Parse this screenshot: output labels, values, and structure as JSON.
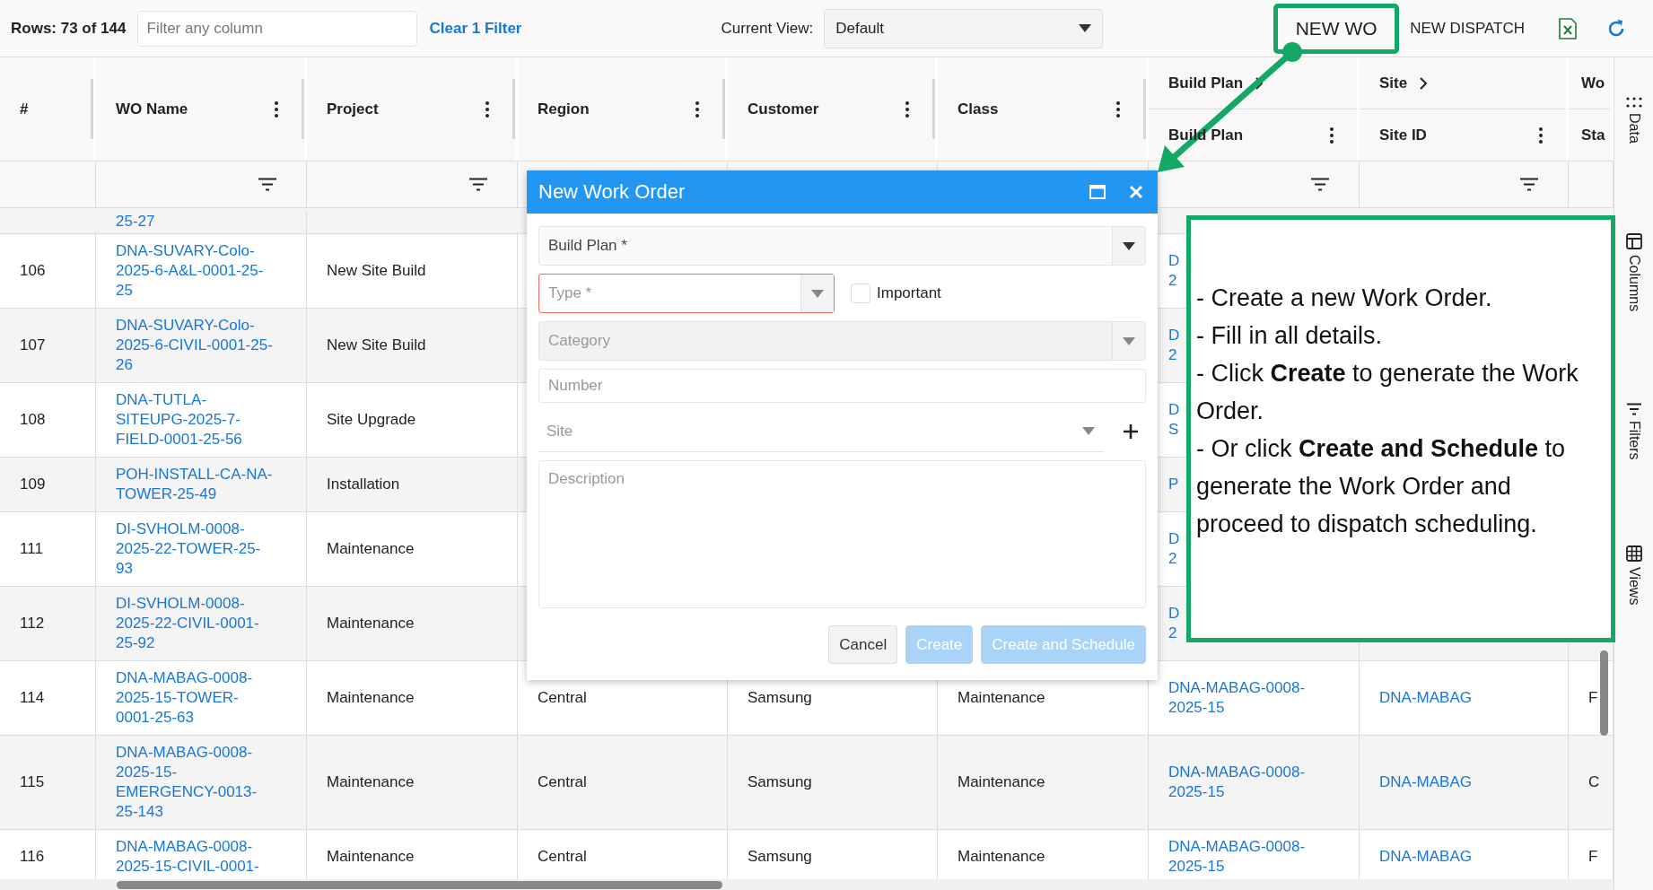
{
  "toolbar": {
    "rows_count": "Rows: 73 of 144",
    "filter": {
      "placeholder": "Filter any column"
    },
    "clear_filter": "Clear 1 Filter",
    "view_label": "Current View:",
    "view_value": "Default",
    "buttons": [
      {
        "label": "NEW WO",
        "highlighted": true
      },
      {
        "label": "NEW DISPATCH",
        "highlighted": false
      }
    ]
  },
  "table": {
    "columns": [
      {
        "label": "#",
        "menu": false,
        "filter": false
      },
      {
        "label": "WO Name",
        "menu": true,
        "filter": true
      },
      {
        "label": "Project",
        "menu": true,
        "filter": true
      },
      {
        "label": "Region",
        "menu": true,
        "filter": false
      },
      {
        "label": "Customer",
        "menu": true,
        "filter": false
      },
      {
        "label": "Class",
        "menu": true,
        "filter": false
      },
      {
        "group": "Build Plan",
        "group_chevron": true,
        "label": "Build Plan",
        "menu": true,
        "filter": true
      },
      {
        "group": "Site",
        "group_chevron": true,
        "label": "Site ID",
        "menu": true,
        "filter": true
      },
      {
        "group": "Wo",
        "group_chevron": false,
        "label": "Sta",
        "menu": false,
        "filter": false
      }
    ],
    "rows": [
      {
        "num": "",
        "wo_name": "25-27"
      },
      {
        "num": "106",
        "wo_name": "DNA-SUVARY-Colo-2025-6-A&L-0001-25-25",
        "project": "New Site Build",
        "build_plan": "D 2",
        "cut": true
      },
      {
        "num": "107",
        "wo_name": "DNA-SUVARY-Colo-2025-6-CIVIL-0001-25-26",
        "project": "New Site Build",
        "build_plan": "D 2",
        "cut": true
      },
      {
        "num": "108",
        "wo_name": "DNA-TUTLA-SITEUPG-2025-7-FIELD-0001-25-56",
        "project": "Site Upgrade",
        "build_plan": "D S",
        "cut": true
      },
      {
        "num": "109",
        "wo_name": "POH-INSTALL-CA-NA-TOWER-25-49",
        "project": "Installation",
        "build_plan": "P",
        "cut": true
      },
      {
        "num": "111",
        "wo_name": "DI-SVHOLM-0008-2025-22-TOWER-25-93",
        "project": "Maintenance",
        "build_plan": "D 2",
        "cut": true
      },
      {
        "num": "112",
        "wo_name": "DI-SVHOLM-0008-2025-22-CIVIL-0001-25-92",
        "project": "Maintenance",
        "build_plan": "D 2",
        "cut": true
      },
      {
        "num": "114",
        "wo_name": "DNA-MABAG-0008-2025-15-TOWER-0001-25-63",
        "project": "Maintenance",
        "region": "Central",
        "customer": "Samsung",
        "class": "Maintenance",
        "build_plan": "DNA-MABAG-0008-2025-15",
        "site_id": "DNA-MABAG",
        "status": "F",
        "cut": false
      },
      {
        "num": "115",
        "wo_name": "DNA-MABAG-0008-2025-15-EMERGENCY-0013-25-143",
        "project": "Maintenance",
        "region": "Central",
        "customer": "Samsung",
        "class": "Maintenance",
        "build_plan": "DNA-MABAG-0008-2025-15",
        "site_id": "DNA-MABAG",
        "status": "C",
        "cut": false
      },
      {
        "num": "116",
        "wo_name": "DNA-MABAG-0008-2025-15-CIVIL-0001-",
        "project": "Maintenance",
        "region": "Central",
        "customer": "Samsung",
        "class": "Maintenance",
        "build_plan": "DNA-MABAG-0008-2025-15",
        "site_id": "DNA-MABAG",
        "status": "F",
        "cut": false
      }
    ]
  },
  "side_panel": [
    {
      "kind": "dots",
      "label": "Data"
    },
    {
      "kind": "columns",
      "label": "Columns"
    },
    {
      "kind": "filter",
      "label": "Filters"
    },
    {
      "kind": "grid",
      "label": "Views"
    }
  ],
  "dialog": {
    "title": "New Work Order",
    "build_plan": {
      "placeholder": "Build Plan *",
      "invalid": false,
      "disabled": false
    },
    "type": {
      "placeholder": "Type *",
      "invalid": true,
      "disabled": false
    },
    "important": {
      "label": "Important",
      "checked": false
    },
    "category": {
      "placeholder": "Category",
      "invalid": false,
      "disabled": true
    },
    "number": {
      "placeholder": "Number"
    },
    "site": {
      "placeholder": "Site"
    },
    "description": {
      "placeholder": "Description"
    },
    "buttons": [
      {
        "label": "Cancel",
        "kind": "secondary",
        "disabled": false
      },
      {
        "label": "Create",
        "kind": "primary",
        "disabled": true
      },
      {
        "label": "Create and Schedule",
        "kind": "primary",
        "disabled": true
      }
    ]
  },
  "note": {
    "lines": [
      "- Create a new Work Order.",
      "- Fill in all details.",
      "- Click **Create** to generate the Work Order.",
      "- Or click **Create and Schedule** to generate the Work Order and proceed to dispatch scheduling."
    ]
  }
}
